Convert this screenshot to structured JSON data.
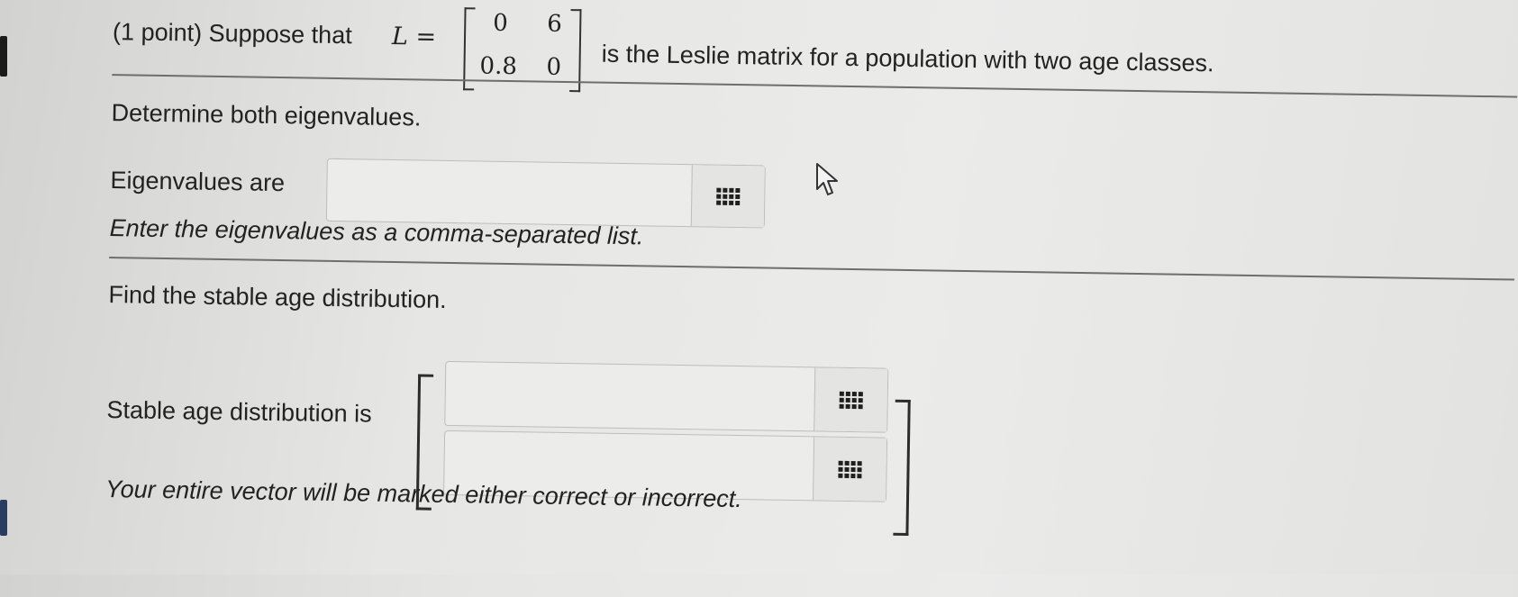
{
  "question": {
    "intro_prefix": "(1 point) Suppose that",
    "matrix_var": "L =",
    "matrix": [
      [
        "0",
        "6"
      ],
      [
        "0.8",
        "0"
      ]
    ],
    "intro_suffix": "is the Leslie matrix for a population with two age classes."
  },
  "part1": {
    "prompt": "Determine both eigenvalues.",
    "label": "Eigenvalues are",
    "input_value": "",
    "hint": "Enter the eigenvalues as a comma-separated list."
  },
  "part2": {
    "prompt": "Find the stable age distribution.",
    "label": "Stable age distribution is",
    "inputs": [
      "",
      ""
    ],
    "note": "Your entire vector will be marked either correct or incorrect."
  },
  "icons": {
    "palette": "keypad-grid-icon",
    "cursor": "mouse-pointer-icon"
  }
}
